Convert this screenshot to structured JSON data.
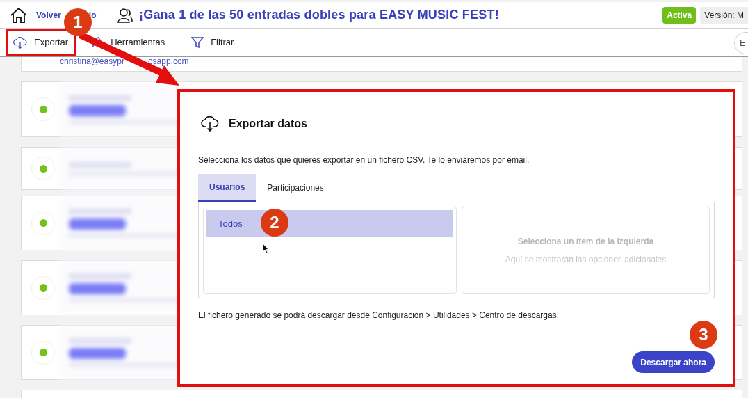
{
  "header": {
    "home_link": [
      "Volver",
      "io"
    ],
    "title": "¡Gana 1 de las 50 entradas dobles para EASY MUSIC FEST!",
    "status_badge": "Activa",
    "version": "Versión: M"
  },
  "toolbar": {
    "buttons": [
      "Exportar",
      "Herramientas",
      "Filtrar"
    ],
    "search_partial": "E"
  },
  "list": {
    "email": [
      "christina@easypr",
      "osapp.com"
    ]
  },
  "modal": {
    "title": "Exportar datos",
    "description": "Selecciona los datos que quieres exportar en un fichero CSV. Te lo enviaremos por email.",
    "tabs": [
      {
        "label": "Usuarios",
        "selected": true
      },
      {
        "label": "Participaciones",
        "selected": false
      }
    ],
    "items": [
      {
        "label": "Todos",
        "selected": true
      }
    ],
    "empty_state": {
      "title": "Selecciona un ítem de la izquierda",
      "hint": "Aquí se mostrarán las opciones adicionales"
    },
    "note": "El fichero generado se podrá descargar desde Configuración > Utilidades > Centro de descargas.",
    "button": "Descargar ahora"
  },
  "annotations": [
    "1",
    "2",
    "3"
  ]
}
